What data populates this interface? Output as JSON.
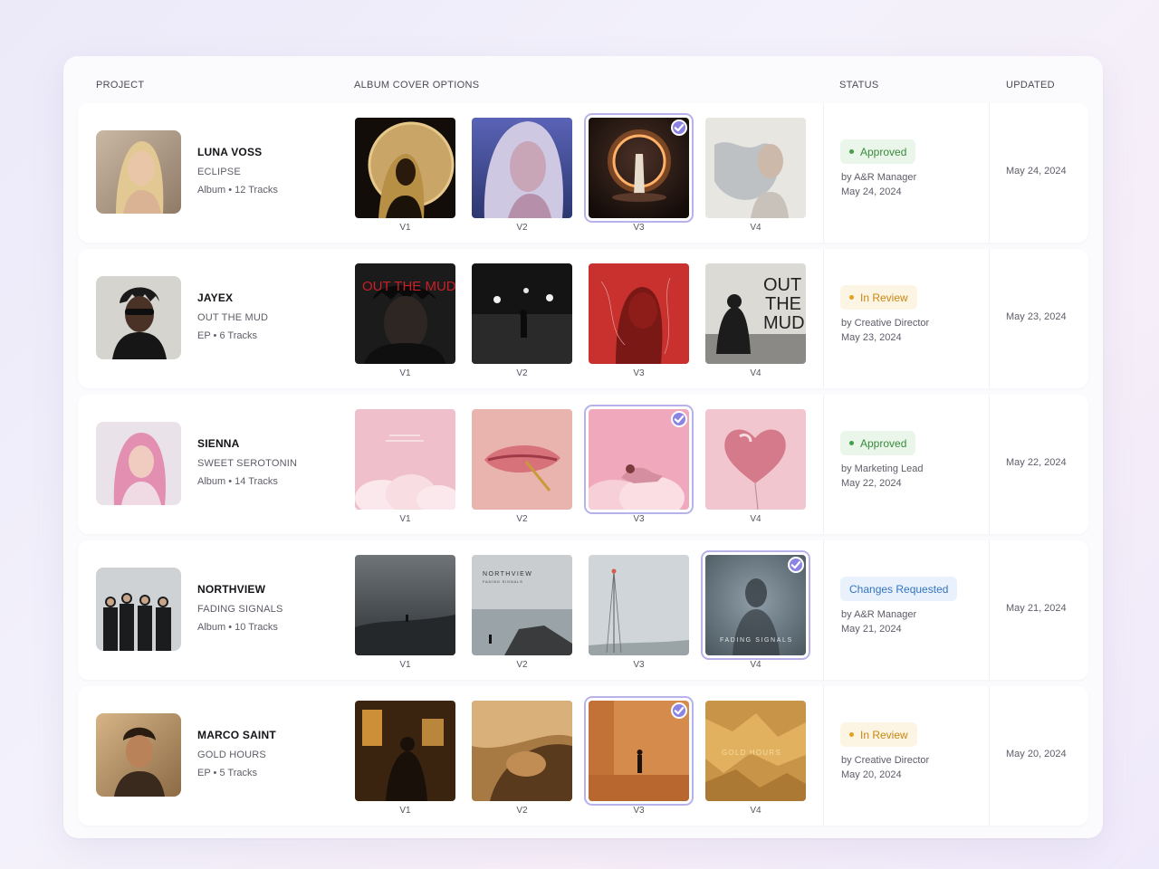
{
  "headers": {
    "project": "PROJECT",
    "covers": "ALBUM COVER OPTIONS",
    "status": "STATUS",
    "updated": "UPDATED"
  },
  "rows": [
    {
      "artist": "LUNA VOSS",
      "title": "ECLIPSE",
      "meta": "Album • 12 Tracks",
      "covers": [
        {
          "label": "V1",
          "selected": false
        },
        {
          "label": "V2",
          "selected": false
        },
        {
          "label": "V3",
          "selected": true
        },
        {
          "label": "V4",
          "selected": false
        }
      ],
      "status": "Approved",
      "status_type": "approved",
      "by": "by A&R Manager",
      "status_date": "May 24, 2024",
      "updated": "May 24, 2024"
    },
    {
      "artist": "JAYEX",
      "title": "OUT THE MUD",
      "meta": "EP • 6 Tracks",
      "cover_text": {
        "v1": "OUT THE MUD",
        "v4_line1": "OUT",
        "v4_line2": "THE",
        "v4_line3": "MUD"
      },
      "covers": [
        {
          "label": "V1",
          "selected": false
        },
        {
          "label": "V2",
          "selected": false
        },
        {
          "label": "V3",
          "selected": false
        },
        {
          "label": "V4",
          "selected": false
        }
      ],
      "status": "In Review",
      "status_type": "review",
      "by": "by Creative Director",
      "status_date": "May 23, 2024",
      "updated": "May 23, 2024"
    },
    {
      "artist": "SIENNA",
      "title": "SWEET SEROTONIN",
      "meta": "Album • 14 Tracks",
      "covers": [
        {
          "label": "V1",
          "selected": false
        },
        {
          "label": "V2",
          "selected": false
        },
        {
          "label": "V3",
          "selected": true
        },
        {
          "label": "V4",
          "selected": false
        }
      ],
      "status": "Approved",
      "status_type": "approved",
      "by": "by Marketing Lead",
      "status_date": "May 22, 2024",
      "updated": "May 22, 2024"
    },
    {
      "artist": "NORTHVIEW",
      "title": "FADING SIGNALS",
      "meta": "Album • 10 Tracks",
      "cover_text": {
        "v2_title": "NORTHVIEW",
        "v2_sub": "FADING SIGNALS",
        "v4_title": "FADING SIGNALS"
      },
      "covers": [
        {
          "label": "V1",
          "selected": false
        },
        {
          "label": "V2",
          "selected": false
        },
        {
          "label": "V3",
          "selected": false
        },
        {
          "label": "V4",
          "selected": true
        }
      ],
      "status": "Changes Requested",
      "status_type": "changes",
      "by": "by A&R Manager",
      "status_date": "May 21, 2024",
      "updated": "May 21, 2024"
    },
    {
      "artist": "MARCO SAINT",
      "title": "GOLD HOURS",
      "meta": "EP • 5 Tracks",
      "cover_text": {
        "v4": "GOLD HOURS"
      },
      "covers": [
        {
          "label": "V1",
          "selected": false
        },
        {
          "label": "V2",
          "selected": false
        },
        {
          "label": "V3",
          "selected": true
        },
        {
          "label": "V4",
          "selected": false
        }
      ],
      "status": "In Review",
      "status_type": "review",
      "by": "by Creative Director",
      "status_date": "May 20, 2024",
      "updated": "May 20, 2024"
    }
  ],
  "icons": {
    "selected": "check-circle-icon",
    "status_dot": "dot-icon"
  },
  "colors": {
    "accent": "#8c84e3",
    "approved": "#43a047",
    "review": "#e3a021",
    "changes": "#3273c0"
  }
}
